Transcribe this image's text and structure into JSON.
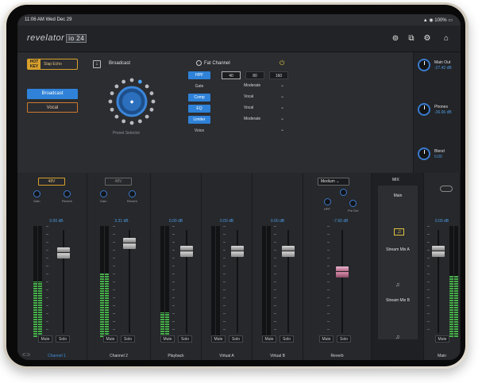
{
  "statusbar": {
    "time": "11:06 AM",
    "date": "Wed Dec 29",
    "battery": "100%"
  },
  "app": {
    "logo": "revelator",
    "logo_suffix": "io 24"
  },
  "hotkey": {
    "key_label": "HOT KEY",
    "value": "Slap Echo"
  },
  "presets": {
    "broadcast": "Broadcast",
    "vocal": "Vocal"
  },
  "broadcast": {
    "title": "Broadcast",
    "selector_label": "Preset Selector"
  },
  "fat_channel": {
    "title": "Fat Channel",
    "hpf": {
      "label": "HPF",
      "options": [
        "40",
        "80",
        "160"
      ],
      "selected": "40"
    },
    "rows": [
      {
        "label": "Gate",
        "value": "Moderate",
        "enabled": false
      },
      {
        "label": "Comp",
        "value": "Vocal",
        "enabled": true
      },
      {
        "label": "EQ",
        "value": "Vocal",
        "enabled": true
      },
      {
        "label": "Limiter",
        "value": "Moderate",
        "enabled": true
      },
      {
        "label": "Voice",
        "value": "",
        "enabled": false
      }
    ]
  },
  "outputs": [
    {
      "label": "Main Out",
      "value": "-27.42 dB"
    },
    {
      "label": "Phones",
      "value": "-36.66 dB"
    },
    {
      "label": "Blend",
      "value": "0.00"
    }
  ],
  "mixer": {
    "phantom_on": "48V",
    "phantom_off": "48V",
    "reverb_type": "Medium",
    "mix_tab": "MIX",
    "knob_labels": {
      "gain": "Gain",
      "reverb": "Reverb",
      "hpf": "HPF",
      "predelay": "Pre Del"
    },
    "mix_items": [
      "Main",
      "Stream Mix A",
      "Stream Mix B"
    ],
    "mute": "Mute",
    "solo": "Solo",
    "channels": [
      {
        "name": "Channel 1",
        "db": "0.00 dB",
        "level": 0.5,
        "active": true
      },
      {
        "name": "Channel 2",
        "db": "3.31 dB",
        "level": 0.58,
        "active": false
      },
      {
        "name": "Playback",
        "db": "0.00 dB",
        "level": 0.22,
        "active": false
      },
      {
        "name": "Virtual A",
        "db": "0.00 dB",
        "level": 0.0,
        "active": false
      },
      {
        "name": "Virtual B",
        "db": "0.00 dB",
        "level": 0.0,
        "active": false
      },
      {
        "name": "Reverb",
        "db": "-7.60 dB",
        "level": 0.0,
        "active": false
      },
      {
        "name": "Main",
        "db": "0.00 dB",
        "level": 0.55,
        "active": false
      }
    ]
  }
}
